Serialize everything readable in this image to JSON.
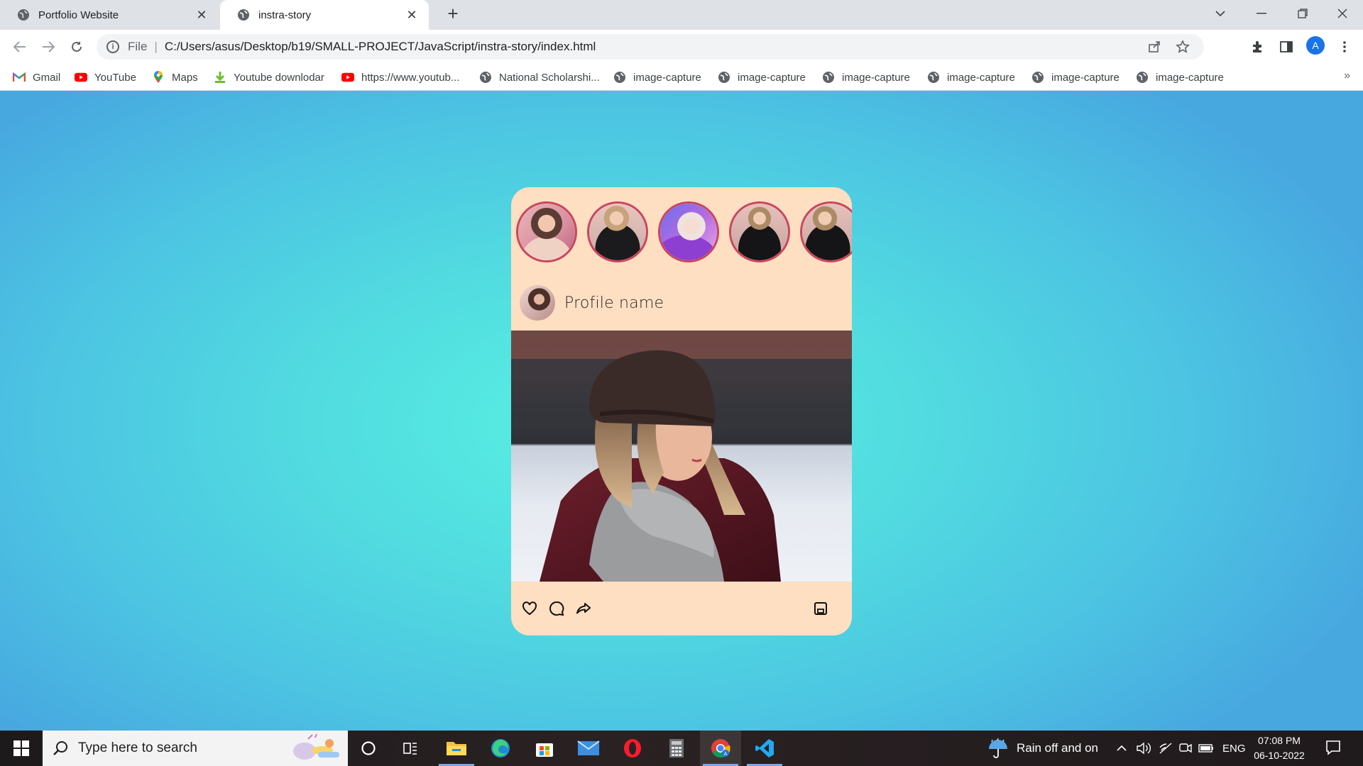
{
  "browser": {
    "tabs": [
      {
        "title": "Portfolio Website",
        "active": false
      },
      {
        "title": "instra-story",
        "active": true
      }
    ],
    "address": {
      "scheme_label": "File",
      "url": "C:/Users/asus/Desktop/b19/SMALL-PROJECT/JavaScript/instra-story/index.html"
    },
    "profile_initial": "A",
    "bookmarks": [
      {
        "label": "Gmail",
        "icon": "gmail-icon"
      },
      {
        "label": "YouTube",
        "icon": "youtube-icon"
      },
      {
        "label": "Maps",
        "icon": "maps-icon"
      },
      {
        "label": "Youtube downlodar",
        "icon": "download-icon"
      },
      {
        "label": "https://www.youtub...",
        "icon": "youtube-icon"
      },
      {
        "label": "National Scholarshi...",
        "icon": "globe-icon"
      },
      {
        "label": "image-capture",
        "icon": "globe-icon"
      },
      {
        "label": "image-capture",
        "icon": "globe-icon"
      },
      {
        "label": "image-capture",
        "icon": "globe-icon"
      },
      {
        "label": "image-capture",
        "icon": "globe-icon"
      },
      {
        "label": "image-capture",
        "icon": "globe-icon"
      },
      {
        "label": "image-capture",
        "icon": "globe-icon"
      }
    ],
    "more_bookmarks": "»"
  },
  "card": {
    "stories_count": 5,
    "profile_name": "Profile name",
    "actions": [
      "heart-icon",
      "comment-icon",
      "share-icon"
    ],
    "save_icon": "save-icon",
    "colors": {
      "card_bg": "#ffdfc2",
      "story_ring": "#c9465f"
    }
  },
  "taskbar": {
    "search_placeholder": "Type here to search",
    "weather": "Rain off and on",
    "language": "ENG",
    "time": "07:08 PM",
    "date": "06-10-2022",
    "apps": [
      "cortana-icon",
      "task-view-icon",
      "file-explorer-icon",
      "edge-icon",
      "store-icon",
      "mail-icon",
      "opera-icon",
      "calculator-icon",
      "chrome-icon",
      "vscode-icon"
    ]
  }
}
